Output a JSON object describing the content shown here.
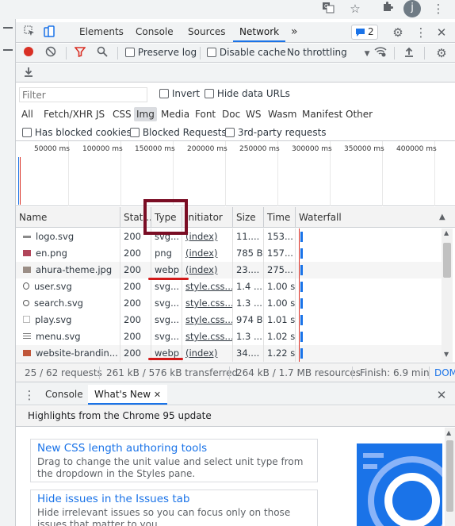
{
  "browser": {
    "avatar_letter": "j",
    "icons": [
      "translate-icon",
      "star-icon",
      "extensions-icon",
      "avatar",
      "more-vert-icon"
    ]
  },
  "devtools": {
    "tabs": [
      {
        "label": "Elements"
      },
      {
        "label": "Console"
      },
      {
        "label": "Sources"
      },
      {
        "label": "Network"
      }
    ],
    "active_tab": "Network",
    "more_tabs_glyph": "»",
    "issues_count": "2"
  },
  "network_toolbar": {
    "preserve_log": "Preserve log",
    "disable_cache": "Disable cache",
    "throttling": "No throttling"
  },
  "filter_bar": {
    "placeholder": "Filter",
    "invert": "Invert",
    "hide_data_urls": "Hide data URLs",
    "types": [
      "All",
      "Fetch/XHR",
      "JS",
      "CSS",
      "Img",
      "Media",
      "Font",
      "Doc",
      "WS",
      "Wasm",
      "Manifest",
      "Other"
    ],
    "selected_type": "Img",
    "has_blocked_cookies": "Has blocked cookies",
    "blocked_requests": "Blocked Requests",
    "third_party": "3rd-party requests"
  },
  "overview": {
    "ticks": [
      "50000 ms",
      "100000 ms",
      "150000 ms",
      "200000 ms",
      "250000 ms",
      "300000 ms",
      "350000 ms",
      "400000 ms"
    ]
  },
  "table": {
    "columns": {
      "name": "Name",
      "status": "Stat...",
      "type": "Type",
      "initiator": "Initiator",
      "size": "Size",
      "time": "Time",
      "waterfall": "Waterfall"
    },
    "rows": [
      {
        "name": "logo.svg",
        "status": "200",
        "type": "svg...",
        "initiator": "(index)",
        "size": "11....",
        "time": "153...",
        "icon": "#8a8a8a"
      },
      {
        "name": "en.png",
        "status": "200",
        "type": "png",
        "initiator": "(index)",
        "size": "785 B",
        "time": "157...",
        "icon": "#b1455a"
      },
      {
        "name": "ahura-theme.jpg",
        "status": "200",
        "type": "webp",
        "initiator": "(index)",
        "size": "23....",
        "time": "275...",
        "icon": "#9b8e86"
      },
      {
        "name": "user.svg",
        "status": "200",
        "type": "svg...",
        "initiator": "style.css...",
        "size": "1.4 ...",
        "time": "1.00 s",
        "icon": "#555"
      },
      {
        "name": "search.svg",
        "status": "200",
        "type": "svg...",
        "initiator": "style.css...",
        "size": "1.3 ...",
        "time": "1.00 s",
        "icon": "#555"
      },
      {
        "name": "play.svg",
        "status": "200",
        "type": "svg...",
        "initiator": "style.css...",
        "size": "974 B",
        "time": "1.01 s",
        "icon": "#bbb"
      },
      {
        "name": "menu.svg",
        "status": "200",
        "type": "svg...",
        "initiator": "style.css...",
        "size": "1.3 ...",
        "time": "1.02 s",
        "icon": "#777"
      },
      {
        "name": "website-brandin...",
        "status": "200",
        "type": "webp",
        "initiator": "(index)",
        "size": "34....",
        "time": "1.22 s",
        "icon": "#c0563a"
      }
    ]
  },
  "status_bar": {
    "requests": "25 / 62 requests",
    "transferred": "261 kB / 576 kB transferred",
    "resources": "264 kB / 1.7 MB resources",
    "finish": "Finish: 6.9 min",
    "dom": "DOM"
  },
  "drawer": {
    "tabs": [
      {
        "label": "Console"
      },
      {
        "label": "What's New"
      }
    ],
    "active_tab": "What's New",
    "highlights": "Highlights from the Chrome 95 update",
    "cards": [
      {
        "title": "New CSS length authoring tools",
        "desc": "Drag to change the unit value and select unit type from the dropdown in the Styles pane."
      },
      {
        "title": "Hide issues in the Issues tab",
        "desc": "Hide irrelevant issues so you can focus only on those issues that matter to you."
      }
    ]
  },
  "colors": {
    "accent": "#1a73e8",
    "record": "#d93025",
    "filter_funnel": "#d93025",
    "annotation_box": "#7a0d24",
    "annotation_underline": "#d21a1a"
  }
}
